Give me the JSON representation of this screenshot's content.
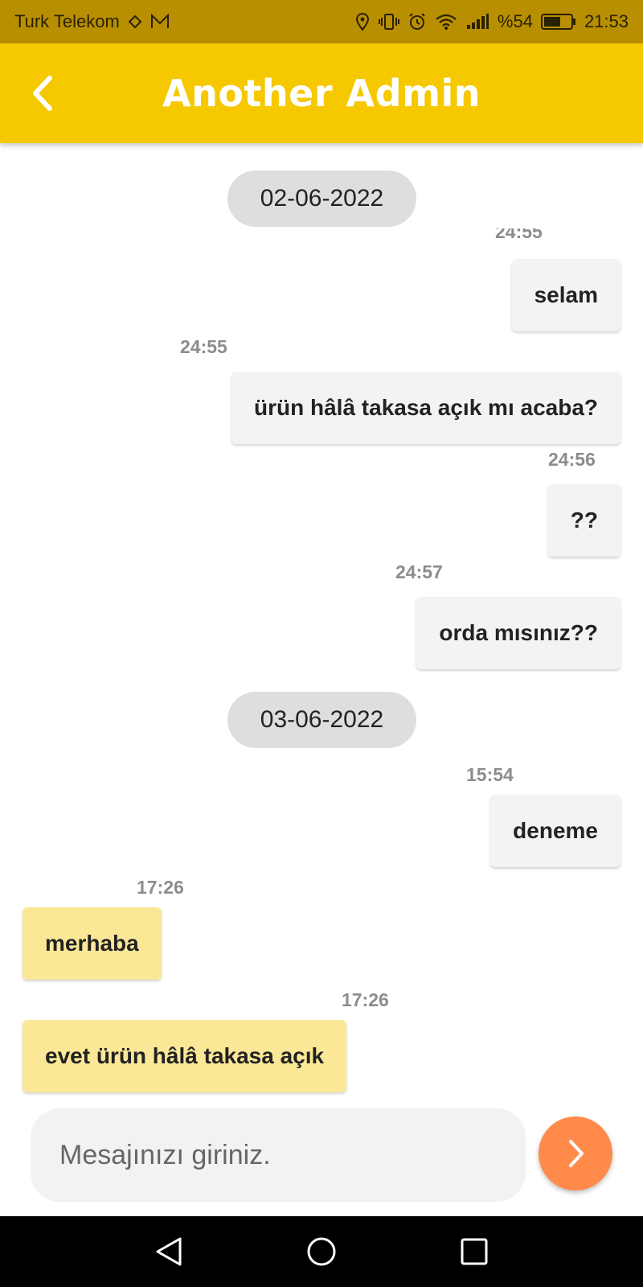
{
  "status_bar": {
    "carrier": "Turk Telekom",
    "battery": "%54",
    "time": "21:53"
  },
  "header": {
    "title": "Another Admin",
    "back_icon": "chevron-left-icon"
  },
  "chat": {
    "dates": [
      "02-06-2022",
      "03-06-2022"
    ],
    "messages": [
      {
        "time": "24:55",
        "text": "selam",
        "direction": "out"
      },
      {
        "time": "24:55",
        "text": "ürün hâlâ takasa açık mı acaba?",
        "direction": "out"
      },
      {
        "time": "24:56",
        "text": "??",
        "direction": "out"
      },
      {
        "time": "24:57",
        "text": "orda mısınız??",
        "direction": "out"
      },
      {
        "time": "15:54",
        "text": "deneme",
        "direction": "out"
      },
      {
        "time": "17:26",
        "text": "merhaba",
        "direction": "in"
      },
      {
        "time": "17:26",
        "text": "evet ürün hâlâ takasa açık",
        "direction": "in"
      }
    ]
  },
  "composer": {
    "placeholder": "Mesajınızı giriniz.",
    "send_icon": "chevron-right-icon"
  },
  "colors": {
    "app_bar": "#f5c800",
    "status_bar": "#b88f00",
    "incoming_bubble": "#fbe897",
    "outgoing_bubble": "#f3f3f3",
    "send_button": "#ff8a4a"
  }
}
